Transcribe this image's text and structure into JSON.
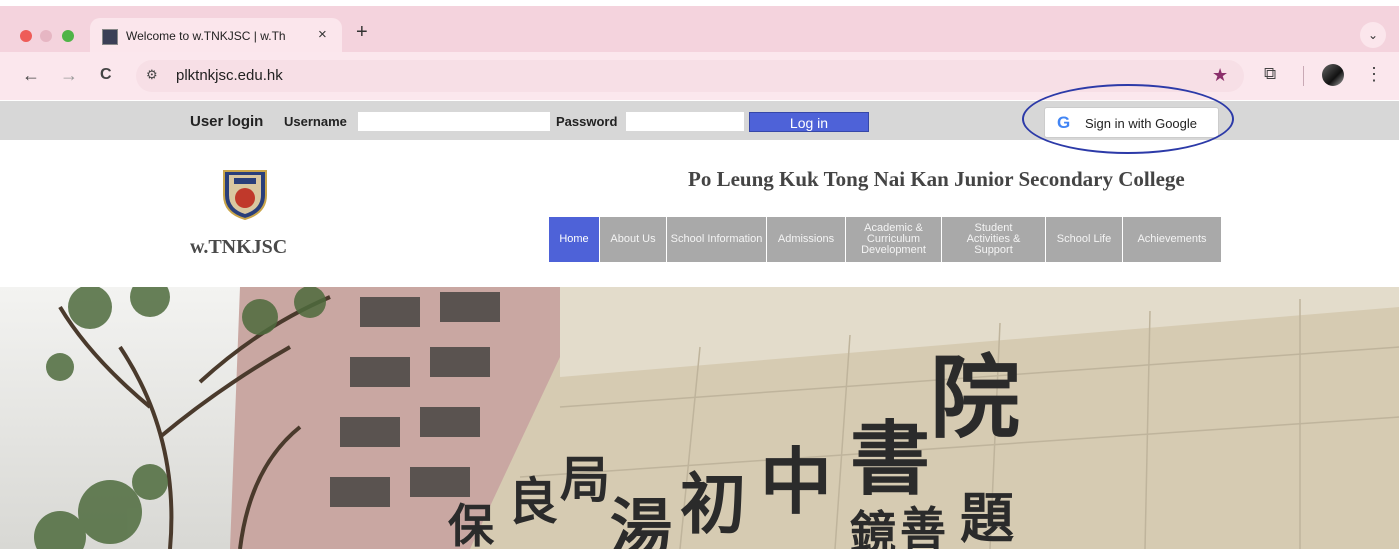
{
  "browser": {
    "tab_title": "Welcome to w.TNKJSC | w.Th",
    "tab_close": "×",
    "new_tab": "+",
    "tab_menu": "⌄",
    "back": "←",
    "forward": "→",
    "reload": "C",
    "site_info_icon": "⚙",
    "url": "plktnkjsc.edu.hk",
    "star": "★",
    "extensions": "⧉",
    "menu": "⋮"
  },
  "login": {
    "title": "User login",
    "username_label": "Username",
    "username_value": "",
    "password_label": "Password",
    "password_value": "",
    "login_button": "Log in",
    "google_button": "Sign in with Google",
    "google_glyph": "G"
  },
  "header": {
    "site_name": "w.TNKJSC",
    "school_name": "Po Leung Kuk Tong Nai Kan Junior Secondary College"
  },
  "nav": [
    {
      "label": "Home",
      "active": true
    },
    {
      "label": "About Us"
    },
    {
      "label": "School Information"
    },
    {
      "label": "Admissions"
    },
    {
      "label": "Academic & Curriculum Development"
    },
    {
      "label": "Student Activities & Support"
    },
    {
      "label": "School Life"
    },
    {
      "label": "Achievements"
    }
  ],
  "hero": {
    "sign_characters": [
      "保",
      "良",
      "局",
      "湯",
      "初",
      "中",
      "書",
      "院"
    ],
    "sign_caption": [
      "鏡",
      "善",
      "題"
    ]
  },
  "colors": {
    "accent": "#4e62d8",
    "nav_gray": "#a9a9a9",
    "login_bar": "#d7d7d7",
    "tab_bar": "#f4d3dd",
    "annotation": "#2c3aa8"
  }
}
